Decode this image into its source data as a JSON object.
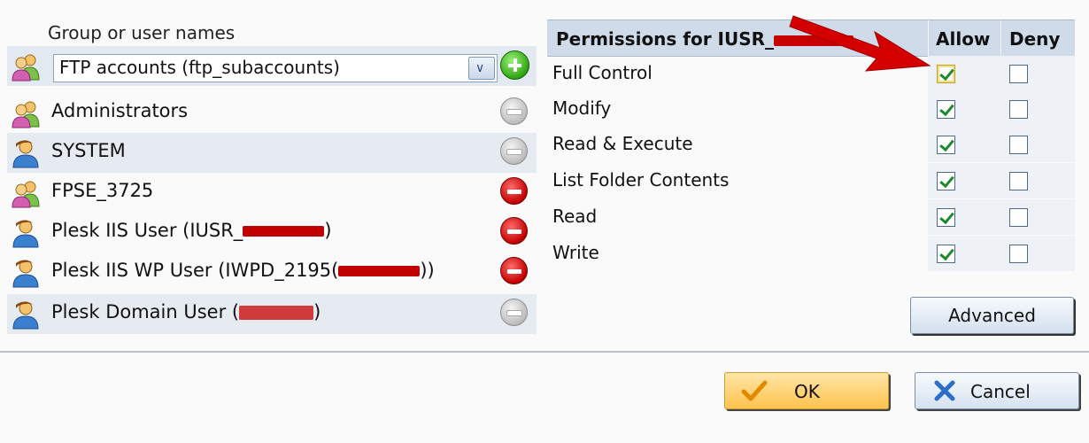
{
  "groups": {
    "label": "Group or user names",
    "select_value": "FTP accounts (ftp_subaccounts)",
    "items": [
      {
        "name": "Administrators",
        "suffix": ""
      },
      {
        "name": "SYSTEM",
        "suffix": ""
      },
      {
        "name": "FPSE_3725",
        "suffix": ""
      },
      {
        "name": "Plesk IIS User (IUSR_",
        "suffix": ")"
      },
      {
        "name": "Plesk IIS WP User (IWPD_2195(",
        "suffix": "))"
      },
      {
        "name": "Plesk Domain User (",
        "suffix": ")"
      }
    ]
  },
  "permissions": {
    "title": "Permissions for IUSR_",
    "allow_label": "Allow",
    "deny_label": "Deny",
    "rows": [
      {
        "label": "Full Control",
        "allow": true,
        "deny": false
      },
      {
        "label": "Modify",
        "allow": true,
        "deny": false
      },
      {
        "label": "Read & Execute",
        "allow": true,
        "deny": false
      },
      {
        "label": "List Folder Contents",
        "allow": true,
        "deny": false
      },
      {
        "label": "Read",
        "allow": true,
        "deny": false
      },
      {
        "label": "Write",
        "allow": true,
        "deny": false
      }
    ]
  },
  "buttons": {
    "advanced": "Advanced",
    "ok": "OK",
    "cancel": "Cancel"
  },
  "colors": {
    "header_bg": "#cfdbe8",
    "alt_row_bg": "#e6ebf1",
    "remove_red": "#c30000",
    "add_green": "#2fa512",
    "annotation_arrow": "#d40000",
    "ok_orange": "#ffc34d"
  }
}
